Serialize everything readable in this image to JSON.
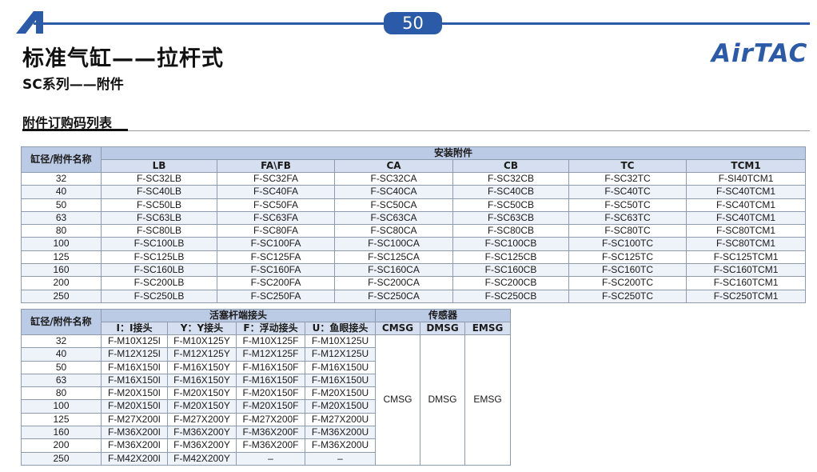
{
  "header": {
    "page_number": "50",
    "title": "标准气缸——拉杆式",
    "subtitle": "SC系列——附件",
    "brand": "AirTAC",
    "colors": {
      "accent": "#2a5aa8",
      "header_fill": "#d6dfef",
      "group_fill": "#bccbe5"
    }
  },
  "section": {
    "title": "附件订购码列表"
  },
  "table1": {
    "corner_header": "缸径/附件名称",
    "group_header": "安装附件",
    "columns": [
      "LB",
      "FA\\FB",
      "CA",
      "CB",
      "TC",
      "TCM1"
    ],
    "rows": [
      [
        "32",
        "F-SC32LB",
        "F-SC32FA",
        "F-SC32CA",
        "F-SC32CB",
        "F-SC32TC",
        "F-SI40TCM1"
      ],
      [
        "40",
        "F-SC40LB",
        "F-SC40FA",
        "F-SC40CA",
        "F-SC40CB",
        "F-SC40TC",
        "F-SC40TCM1"
      ],
      [
        "50",
        "F-SC50LB",
        "F-SC50FA",
        "F-SC50CA",
        "F-SC50CB",
        "F-SC50TC",
        "F-SC40TCM1"
      ],
      [
        "63",
        "F-SC63LB",
        "F-SC63FA",
        "F-SC63CA",
        "F-SC63CB",
        "F-SC63TC",
        "F-SC40TCM1"
      ],
      [
        "80",
        "F-SC80LB",
        "F-SC80FA",
        "F-SC80CA",
        "F-SC80CB",
        "F-SC80TC",
        "F-SC80TCM1"
      ],
      [
        "100",
        "F-SC100LB",
        "F-SC100FA",
        "F-SC100CA",
        "F-SC100CB",
        "F-SC100TC",
        "F-SC80TCM1"
      ],
      [
        "125",
        "F-SC125LB",
        "F-SC125FA",
        "F-SC125CA",
        "F-SC125CB",
        "F-SC125TC",
        "F-SC125TCM1"
      ],
      [
        "160",
        "F-SC160LB",
        "F-SC160FA",
        "F-SC160CA",
        "F-SC160CB",
        "F-SC160TC",
        "F-SC160TCM1"
      ],
      [
        "200",
        "F-SC200LB",
        "F-SC200FA",
        "F-SC200CA",
        "F-SC200CB",
        "F-SC200TC",
        "F-SC160TCM1"
      ],
      [
        "250",
        "F-SC250LB",
        "F-SC250FA",
        "F-SC250CA",
        "F-SC250CB",
        "F-SC250TC",
        "F-SC250TCM1"
      ]
    ]
  },
  "table2": {
    "corner_header": "缸径/附件名称",
    "group_rod": "活塞杆端接头",
    "group_sensor": "传感器",
    "rod_columns": [
      "I：I接头",
      "Y：Y接头",
      "F：浮动接头",
      "U：鱼眼接头"
    ],
    "sensor_columns": [
      "CMSG",
      "DMSG",
      "EMSG"
    ],
    "sensor_values": [
      "CMSG",
      "DMSG",
      "EMSG"
    ],
    "rows": [
      [
        "32",
        "F-M10X125I",
        "F-M10X125Y",
        "F-M10X125F",
        "F-M10X125U"
      ],
      [
        "40",
        "F-M12X125I",
        "F-M12X125Y",
        "F-M12X125F",
        "F-M12X125U"
      ],
      [
        "50",
        "F-M16X150I",
        "F-M16X150Y",
        "F-M16X150F",
        "F-M16X150U"
      ],
      [
        "63",
        "F-M16X150I",
        "F-M16X150Y",
        "F-M16X150F",
        "F-M16X150U"
      ],
      [
        "80",
        "F-M20X150I",
        "F-M20X150Y",
        "F-M20X150F",
        "F-M20X150U"
      ],
      [
        "100",
        "F-M20X150I",
        "F-M20X150Y",
        "F-M20X150F",
        "F-M20X150U"
      ],
      [
        "125",
        "F-M27X200I",
        "F-M27X200Y",
        "F-M27X200F",
        "F-M27X200U"
      ],
      [
        "160",
        "F-M36X200I",
        "F-M36X200Y",
        "F-M36X200F",
        "F-M36X200U"
      ],
      [
        "200",
        "F-M36X200I",
        "F-M36X200Y",
        "F-M36X200F",
        "F-M36X200U"
      ],
      [
        "250",
        "F-M42X200I",
        "F-M42X200Y",
        "–",
        "–"
      ]
    ]
  }
}
